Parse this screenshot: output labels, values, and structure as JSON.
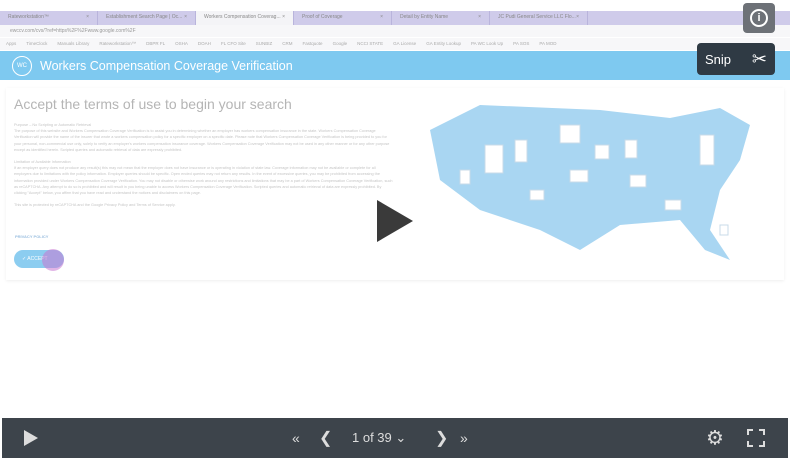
{
  "browser": {
    "tabs": [
      {
        "label": "Rateworkstation™"
      },
      {
        "label": "Establishment Search Page | Oc..."
      },
      {
        "label": "Workers Compensation Coverag...",
        "active": true
      },
      {
        "label": "Proof of Coverage"
      },
      {
        "label": "Detail by Entity Name"
      },
      {
        "label": "JC Pudi General Service LLC Flo..."
      }
    ],
    "url": "ewccv.com/cvs/?ref=https%2F%2Fwww.google.com%2F",
    "bookmarks": [
      "Apps",
      "TimeClock",
      "Manuals Library",
      "Rateworkstation™",
      "DBPR FL",
      "OSHA",
      "DOAH",
      "FL CFO Site",
      "SUNBIZ",
      "CRM",
      "Fastquote",
      "Google",
      "NCCI STATE",
      "GA License",
      "GA Entity Lookup",
      "PA WC Look Up",
      "PA SOS",
      "PA MOD"
    ]
  },
  "site": {
    "logo": "WC",
    "title": "Workers Compensation Coverage Verification",
    "heading": "Accept the terms of use to begin your search",
    "section1_title": "Purpose – No Scripting or Automatic Retrieval",
    "section1_text": "The purpose of this website and Workers Compensation Coverage Verification is to assist you in determining whether an employer has workers compensation insurance in the state. Workers Compensation Coverage Verification will provide the name of the insurer that wrote a workers compensation policy for a specific employer on a specific date. Please note that Workers Compensation Coverage Verification is being provided to you for your personal, non-commercial use only, solely to verify an employer's workers compensation insurance coverage. Workers Compensation Coverage Verification may not be used in any other manner or for any other purpose except as identified herein. Scripted queries and automatic retrieval of data are expressly prohibited.",
    "section2_title": "Limitation of Available Information",
    "section2_text": "If an employer query does not produce any result(s) this may not mean that the employer does not have insurance or is operating in violation of state law. Coverage information may not be available or complete for all employers due to limitations with the policy information. Employer queries should be specific. Open ended queries may not return any results. In the event of excessive queries, you may be prohibited from accessing the information provided under Workers Compensation Coverage Verification. You may not disable or otherwise work around any restrictions and limitations that may be a part of Workers Compensation Coverage Verification, such as reCAPTCHA. Any attempt to do so is prohibited and will result in you being unable to access Workers Compensation Coverage Verification. Scripted queries and automatic retrieval of data are expressly prohibited. By clicking \"Accept\" below, you affirm that you have read and understand the notices and disclaimers on this page.",
    "recaptcha_text": "This site is protected by reCAPTCHA and the Google Privacy Policy and Terms of Service apply.",
    "privacy_policy": "PRIVACY POLICY",
    "accept": "✓ ACCEPT"
  },
  "overlay": {
    "snip": "Snip",
    "snip_icon": "✂",
    "info_icon": "i"
  },
  "player": {
    "page": "1 of 39",
    "first": "«",
    "prev": "❮",
    "next": "❯",
    "last": "»",
    "dropdown": "⌄",
    "settings_icon": "⚙"
  }
}
